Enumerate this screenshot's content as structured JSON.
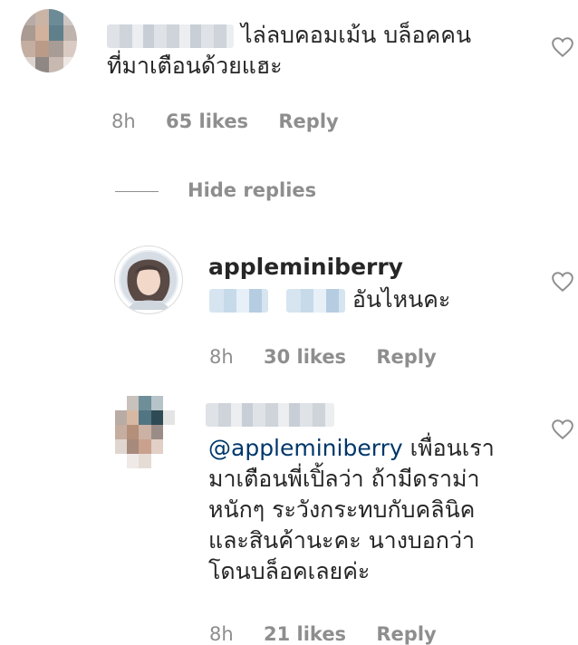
{
  "comments": [
    {
      "text_lines": [
        "ไล่ลบคอมเม้น บล็อคคน",
        "ที่มาเตือนด้วยแฮะ"
      ],
      "time": "8h",
      "likes": "65 likes",
      "reply": "Reply"
    }
  ],
  "hide_replies": "Hide replies",
  "replies": [
    {
      "username": "appleminiberry",
      "text": "อันไหนคะ",
      "time": "8h",
      "likes": "30 likes",
      "reply": "Reply"
    },
    {
      "mention": "@appleminiberry",
      "text_lines": [
        "เพื่อนเรา",
        "มาเตือนพี่เปิ้ลว่า ถ้ามีดราม่า",
        "หนักๆ ระวังกระทบกับคลินิค",
        "และสินค้านะคะ นางบอกว่า",
        "โดนบล็อคเลยค่ะ"
      ],
      "time": "8h",
      "likes": "21 likes",
      "reply": "Reply"
    }
  ],
  "icons": {
    "like": "heart-outline-icon"
  },
  "colors": {
    "text": "#262626",
    "meta": "#8e8e8e",
    "mention": "#00376b"
  }
}
